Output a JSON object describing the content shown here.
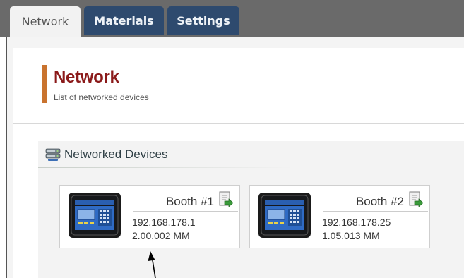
{
  "tabs": [
    {
      "label": "Network",
      "active": true
    },
    {
      "label": "Materials",
      "active": false
    },
    {
      "label": "Settings",
      "active": false
    }
  ],
  "header": {
    "title": "Network",
    "subtitle": "List of networked devices"
  },
  "section": {
    "title": "Networked Devices",
    "icon": "server-icon"
  },
  "devices": [
    {
      "name": "Booth #1",
      "ip": "192.168.178.1",
      "version": "2.00.002 MM",
      "icon": "document-arrow-icon"
    },
    {
      "name": "Booth #2",
      "ip": "192.168.178.25",
      "version": "1.05.013 MM",
      "icon": "document-arrow-icon"
    }
  ],
  "colors": {
    "tab_active_bg": "#f2f2f2",
    "tab_inactive_bg": "#2e4a6e",
    "title_accent": "#c9732e",
    "title_text": "#8b1a1a",
    "icon_green": "#3a9a3a"
  }
}
